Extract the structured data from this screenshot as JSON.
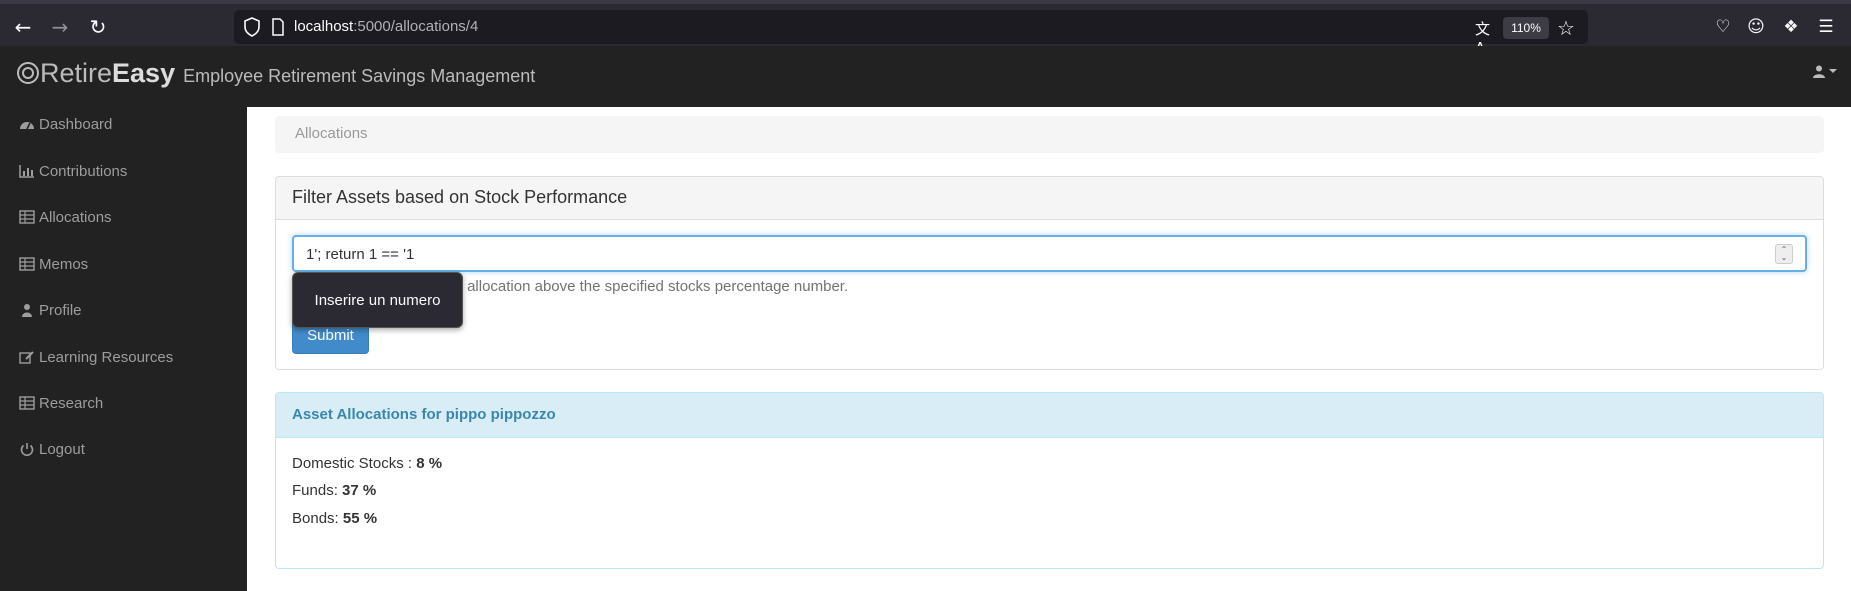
{
  "browser": {
    "url_host": "localhost",
    "url_path": ":5000/allocations/4",
    "zoom": "110%"
  },
  "app": {
    "brand_retire": "Retire",
    "brand_easy": "Easy",
    "tagline": "Employee Retirement Savings Management"
  },
  "sidebar": {
    "items": [
      {
        "label": "Dashboard",
        "icon": "dashboard-icon"
      },
      {
        "label": "Contributions",
        "icon": "bar-chart-icon"
      },
      {
        "label": "Allocations",
        "icon": "table-icon"
      },
      {
        "label": "Memos",
        "icon": "table-icon"
      },
      {
        "label": "Profile",
        "icon": "user-icon"
      },
      {
        "label": "Learning Resources",
        "icon": "edit-icon"
      },
      {
        "label": "Research",
        "icon": "table-icon"
      },
      {
        "label": "Logout",
        "icon": "power-icon"
      }
    ]
  },
  "breadcrumb": "Allocations",
  "filter": {
    "title": "Filter Assets based on Stock Performance",
    "input_value": "1'; return 1 == '1",
    "help_text": "lue, it will return all assets allocation above the specified stocks percentage number.",
    "submit_label": "Submit",
    "tooltip": "Inserire un numero"
  },
  "allocations": {
    "title": "Asset Allocations for pippo pippozzo",
    "domestic_label": "Domestic Stocks : ",
    "domestic_value": "8 %",
    "funds_label": "Funds: ",
    "funds_value": "37 %",
    "bonds_label": "Bonds: ",
    "bonds_value": "55 %"
  },
  "colors": {
    "navbar": "#222222",
    "accent": "#428bca",
    "info_heading": "#d9edf7"
  }
}
